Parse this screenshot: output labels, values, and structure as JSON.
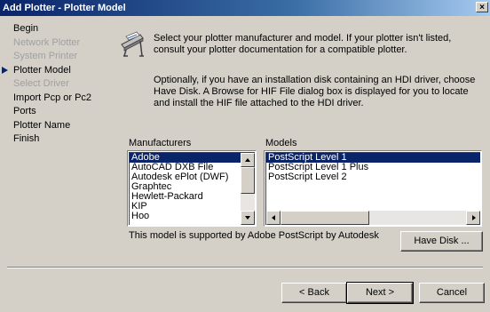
{
  "window": {
    "title": "Add Plotter - Plotter Model",
    "close_glyph": "×"
  },
  "steps": [
    {
      "label": "Begin",
      "state": "enabled"
    },
    {
      "label": "Network Plotter",
      "state": "disabled"
    },
    {
      "label": "System Printer",
      "state": "disabled"
    },
    {
      "label": "Plotter Model",
      "state": "current"
    },
    {
      "label": "Select Driver",
      "state": "disabled"
    },
    {
      "label": "Import Pcp or Pc2",
      "state": "enabled"
    },
    {
      "label": "Ports",
      "state": "enabled"
    },
    {
      "label": "Plotter Name",
      "state": "enabled"
    },
    {
      "label": "Finish",
      "state": "enabled"
    }
  ],
  "content": {
    "intro": "Select your plotter manufacturer and model. If your plotter isn't listed, consult your plotter documentation for a compatible plotter.",
    "disk_note": "Optionally, if you have an installation disk containing an HDI driver, choose Have Disk. A Browse for HIF File dialog box is displayed for you to locate and install the HIF file attached to the HDI driver.",
    "manufacturers_label": "Manufacturers",
    "models_label": "Models",
    "manufacturers": [
      "Adobe",
      "AutoCAD DXB File",
      "Autodesk ePlot (DWF)",
      "Graphtec",
      "Hewlett-Packard",
      "KIP",
      "Hoo"
    ],
    "selected_manufacturer": 0,
    "models": [
      "PostScript Level 1",
      "PostScript Level 1 Plus",
      "PostScript Level 2"
    ],
    "selected_model": 0,
    "support_text": "This model is supported by Adobe PostScript by Autodesk",
    "have_disk_label": "Have Disk ..."
  },
  "footer": {
    "back_label": "< Back",
    "next_label": "Next >",
    "cancel_label": "Cancel"
  },
  "colors": {
    "face": "#d4d0c8",
    "selection": "#0a246a",
    "title_start": "#0a246a",
    "title_end": "#a6caf0",
    "disabled_text": "#a0a0a0"
  },
  "icons": {
    "wizard": "plotter-icon",
    "current_step": "arrow-right-icon"
  }
}
